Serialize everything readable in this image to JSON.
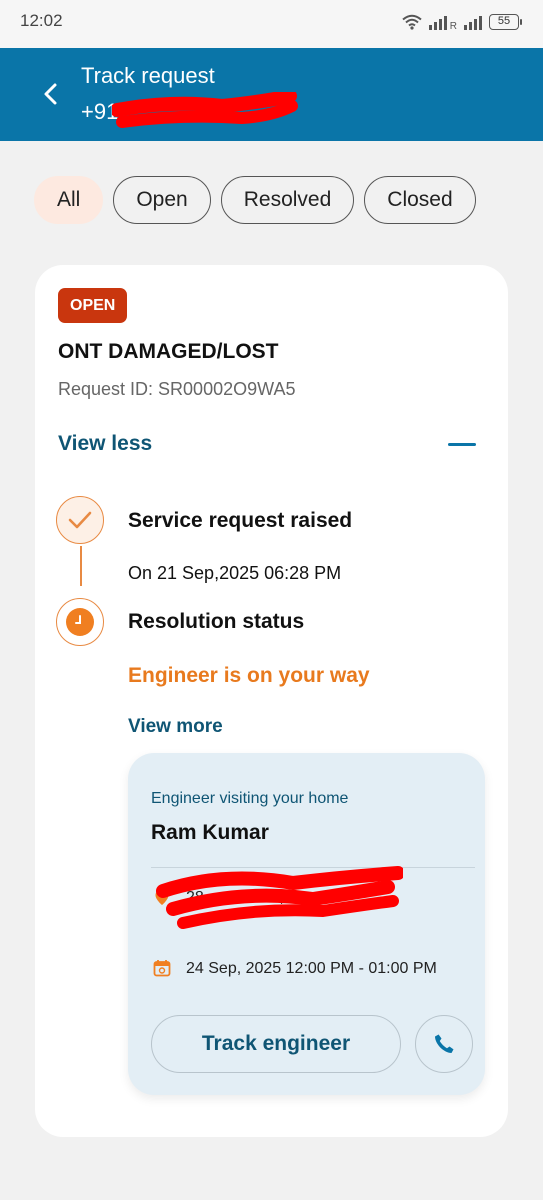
{
  "status_bar": {
    "time": "12:02",
    "battery": "55",
    "roaming": "R"
  },
  "header": {
    "title": "Track request",
    "subtitle": "+91-"
  },
  "filters": [
    {
      "label": "All",
      "active": true
    },
    {
      "label": "Open",
      "active": false
    },
    {
      "label": "Resolved",
      "active": false
    },
    {
      "label": "Closed",
      "active": false
    }
  ],
  "request": {
    "status_badge": "OPEN",
    "title": "ONT DAMAGED/LOST",
    "request_id": "Request ID: SR00002O9WA5",
    "toggle_label": "View less",
    "timeline": [
      {
        "title": "Service request raised",
        "detail": "On 21 Sep,2025 06:28 PM"
      },
      {
        "title": "Resolution status",
        "detail": "Engineer is on your way"
      }
    ],
    "view_more_label": "View more",
    "engineer": {
      "label": "Engineer visiting your home",
      "name": "Ram Kumar",
      "address": "28                        a, 174301,",
      "slot": "24 Sep, 2025 12:00 PM - 01:00 PM",
      "track_button": "Track engineer"
    }
  },
  "colors": {
    "header_bg": "#0a75a8",
    "badge_bg": "#c9360e",
    "accent_orange": "#e87a1e",
    "link_blue": "#0f5574",
    "chip_active_bg": "#fde9e0",
    "engineer_card_bg": "#e3eef5",
    "redaction": "#ff0000"
  },
  "icons": [
    "wifi-icon",
    "signal-icon",
    "battery-icon",
    "back-arrow-icon",
    "minus-icon",
    "check-icon",
    "clock-icon",
    "location-pin-icon",
    "calendar-icon",
    "phone-icon"
  ]
}
